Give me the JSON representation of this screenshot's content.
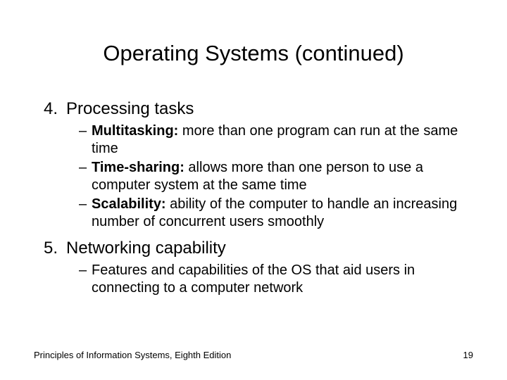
{
  "title": "Operating Systems (continued)",
  "items": [
    {
      "num": "4.",
      "label": "Processing tasks",
      "subs": [
        {
          "bold": "Multitasking:",
          "rest": " more than one program can run at the same time"
        },
        {
          "bold": "Time-sharing:",
          "rest": " allows more than one person to use a computer system at the same time"
        },
        {
          "bold": "Scalability:",
          "rest": " ability of the computer to handle an increasing number of concurrent users smoothly"
        }
      ]
    },
    {
      "num": "5.",
      "label": "Networking capability",
      "subs": [
        {
          "bold": "",
          "rest": "Features and capabilities of the OS that aid users in connecting to a computer network"
        }
      ]
    }
  ],
  "footer": {
    "left": "Principles of Information Systems, Eighth Edition",
    "right": "19"
  }
}
